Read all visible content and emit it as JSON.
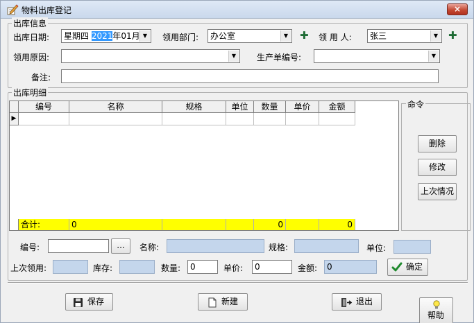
{
  "window": {
    "title": "物料出库登记",
    "close_label": "×"
  },
  "info_group": {
    "title": "出库信息",
    "date_label": "出库日期:",
    "date_value_prefix": "星期四 ",
    "date_value_selected": "2021",
    "date_value_suffix": "年01月",
    "dept_label": "领用部门:",
    "dept_value": "办公室",
    "receiver_label": "领 用 人:",
    "receiver_value": "张三",
    "reason_label": "领用原因:",
    "reason_value": "",
    "order_label": "生产单编号:",
    "order_value": "",
    "remark_label": "备注:",
    "remark_value": ""
  },
  "detail_group": {
    "title": "出库明细",
    "columns": [
      "编号",
      "名称",
      "规格",
      "单位",
      "数量",
      "单价",
      "金额"
    ],
    "row_indicator": "▶",
    "sum_label": "合计:",
    "sum_values": [
      "0",
      "",
      "",
      "",
      "0",
      "",
      "0"
    ]
  },
  "command_group": {
    "title": "命令",
    "delete_label": "删除",
    "edit_label": "修改",
    "last_label": "上次情况"
  },
  "entry": {
    "code_label": "编号:",
    "code_value": "",
    "browse_label": "...",
    "name_label": "名称:",
    "name_value": "",
    "spec_label": "规格:",
    "spec_value": "",
    "unit_label": "单位:",
    "unit_value": "",
    "last_used_label": "上次领用:",
    "last_used_value": "",
    "stock_label": "库存:",
    "stock_value": "",
    "qty_label": "数量:",
    "qty_value": "0",
    "price_label": "单价:",
    "price_value": "0",
    "amount_label": "金额:",
    "amount_value": "0",
    "confirm_label": "确定"
  },
  "footer": {
    "save_label": "保存",
    "new_label": "新建",
    "exit_label": "退出",
    "help_label": "帮助"
  },
  "colors": {
    "sum_row_bg": "#ffff00",
    "readonly_field_bg": "#c4d6ec",
    "selection_bg": "#3399ff",
    "plus_icon": "#1e6b34",
    "confirm_check": "#1f8a2e"
  }
}
